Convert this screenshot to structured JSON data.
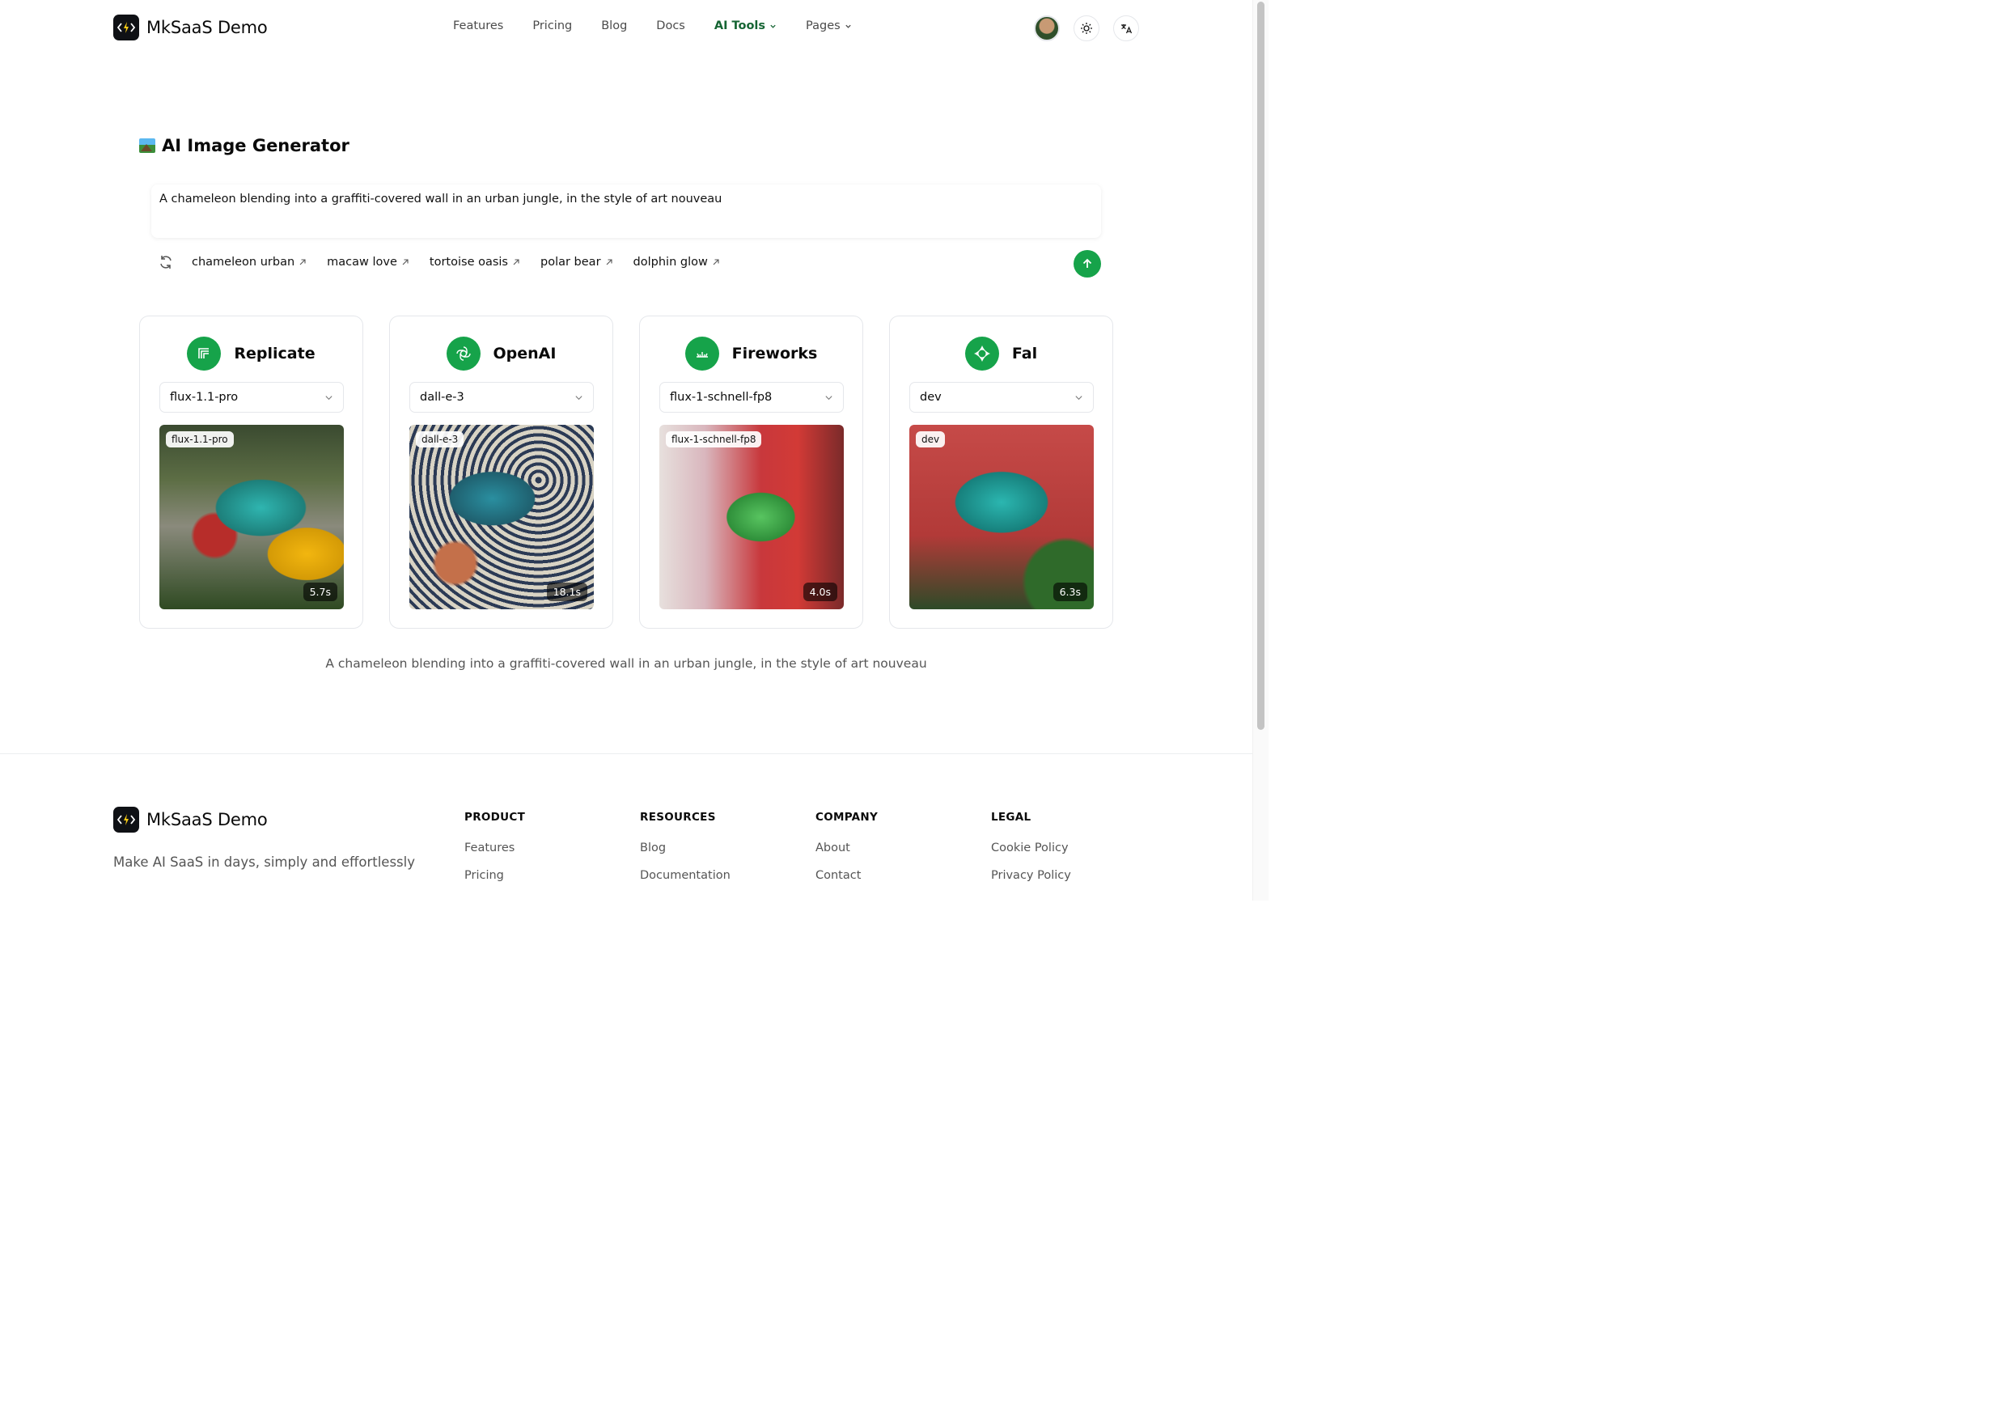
{
  "header": {
    "brand": "MkSaaS Demo",
    "nav": [
      {
        "label": "Features",
        "dropdown": false,
        "active": false
      },
      {
        "label": "Pricing",
        "dropdown": false,
        "active": false
      },
      {
        "label": "Blog",
        "dropdown": false,
        "active": false
      },
      {
        "label": "Docs",
        "dropdown": false,
        "active": false
      },
      {
        "label": "AI Tools",
        "dropdown": true,
        "active": true
      },
      {
        "label": "Pages",
        "dropdown": true,
        "active": false
      }
    ],
    "icons": [
      "avatar",
      "sun-icon",
      "translate-icon"
    ]
  },
  "main": {
    "title": "AI Image Generator",
    "prompt": "A chameleon blending into a graffiti-covered wall in an urban jungle, in the style of art nouveau",
    "suggestions": [
      "chameleon urban",
      "macaw love",
      "tortoise oasis",
      "polar bear",
      "dolphin glow"
    ],
    "providers": [
      {
        "name": "Replicate",
        "model": "flux-1.1-pro",
        "tag": "flux-1.1-pro",
        "time": "5.7s",
        "icon": "replicate-icon"
      },
      {
        "name": "OpenAI",
        "model": "dall-e-3",
        "tag": "dall-e-3",
        "time": "18.1s",
        "icon": "openai-icon"
      },
      {
        "name": "Fireworks",
        "model": "flux-1-schnell-fp8",
        "tag": "flux-1-schnell-fp8",
        "time": "4.0s",
        "icon": "fireworks-icon"
      },
      {
        "name": "Fal",
        "model": "dev",
        "tag": "dev",
        "time": "6.3s",
        "icon": "fal-icon"
      }
    ],
    "caption": "A chameleon blending into a graffiti-covered wall in an urban jungle, in the style of art nouveau"
  },
  "footer": {
    "brand": "MkSaaS Demo",
    "tagline": "Make AI SaaS in days, simply and effortlessly",
    "columns": [
      {
        "title": "PRODUCT",
        "links": [
          "Features",
          "Pricing"
        ]
      },
      {
        "title": "RESOURCES",
        "links": [
          "Blog",
          "Documentation"
        ]
      },
      {
        "title": "COMPANY",
        "links": [
          "About",
          "Contact"
        ]
      },
      {
        "title": "LEGAL",
        "links": [
          "Cookie Policy",
          "Privacy Policy"
        ]
      }
    ]
  },
  "colors": {
    "accent": "#16a34a",
    "nav_active": "#166534",
    "text": "#0a0a0a",
    "muted": "#555555"
  }
}
